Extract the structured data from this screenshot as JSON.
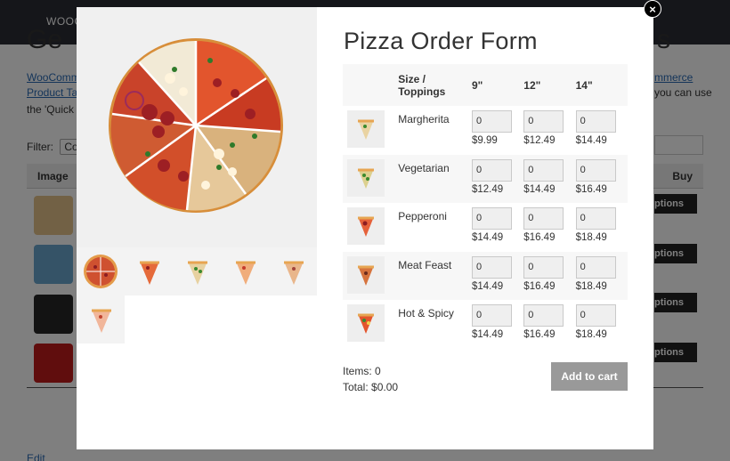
{
  "background": {
    "brand": "WOOC",
    "title_fragment_left": "Ge",
    "title_fragment_right": "s",
    "link_woocommerce": "WooComme",
    "link_product_table": "Product Tab",
    "link_right": "mmerce",
    "text_right": "you can use",
    "text_quick": "the 'Quick v",
    "filter_label": "Filter:",
    "filter_select": "Col",
    "header_image": "Image",
    "header_buy": "Buy",
    "button_options": "ptions",
    "edit_link": "Edit"
  },
  "modal": {
    "close_icon": "×",
    "title": "Pizza Order Form",
    "table": {
      "header_label": "Size / Toppings",
      "sizes": [
        "9\"",
        "12\"",
        "14\""
      ],
      "rows": [
        {
          "name": "Margherita",
          "qty": [
            "0",
            "0",
            "0"
          ],
          "prices": [
            "$9.99",
            "$12.49",
            "$14.49"
          ]
        },
        {
          "name": "Vegetarian",
          "qty": [
            "0",
            "0",
            "0"
          ],
          "prices": [
            "$12.49",
            "$14.49",
            "$16.49"
          ]
        },
        {
          "name": "Pepperoni",
          "qty": [
            "0",
            "0",
            "0"
          ],
          "prices": [
            "$14.49",
            "$16.49",
            "$18.49"
          ]
        },
        {
          "name": "Meat Feast",
          "qty": [
            "0",
            "0",
            "0"
          ],
          "prices": [
            "$14.49",
            "$16.49",
            "$18.49"
          ]
        },
        {
          "name": "Hot & Spicy",
          "qty": [
            "0",
            "0",
            "0"
          ],
          "prices": [
            "$14.49",
            "$16.49",
            "$18.49"
          ]
        }
      ]
    },
    "items_label": "Items: 0",
    "total_label": "Total: $0.00",
    "add_to_cart": "Add to cart"
  },
  "colors": {
    "accent_link": "#2a6bb5",
    "header_dark": "#2b2d34",
    "button_disabled": "#999999"
  }
}
